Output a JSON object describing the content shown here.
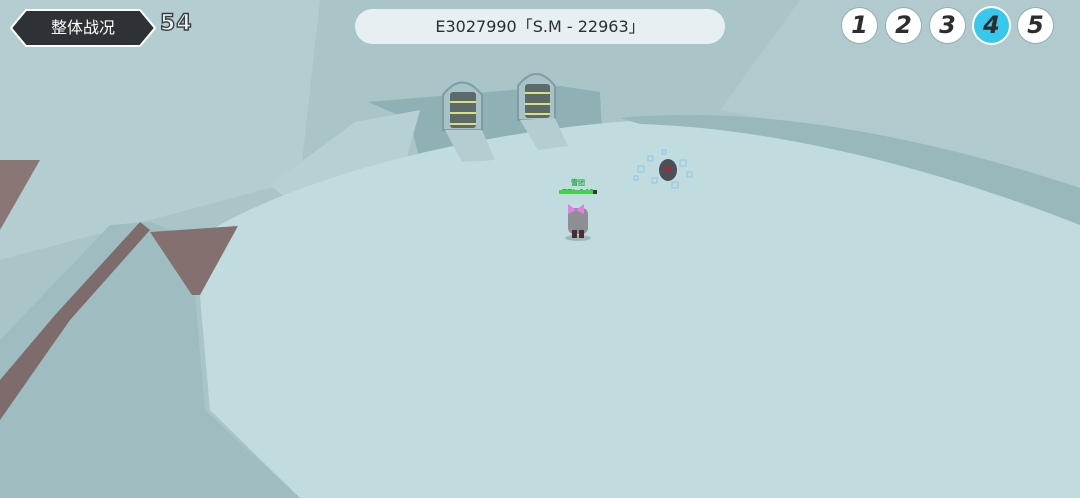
{
  "hud": {
    "back_label": "整体战况",
    "count": "54",
    "room_label": "E3027990「S.M - 22963」",
    "slots": [
      {
        "label": "1",
        "active": false
      },
      {
        "label": "2",
        "active": false
      },
      {
        "label": "3",
        "active": false
      },
      {
        "label": "4",
        "active": true
      },
      {
        "label": "5",
        "active": false
      }
    ]
  },
  "player": {
    "name_tag": "雪团 ZZL.140",
    "hp_fraction": 0.9
  },
  "colors": {
    "floor": "#c1dcdf",
    "wall": "#9cb9bd",
    "accent": "#38c8ec",
    "hud_dark": "#2e3236"
  }
}
